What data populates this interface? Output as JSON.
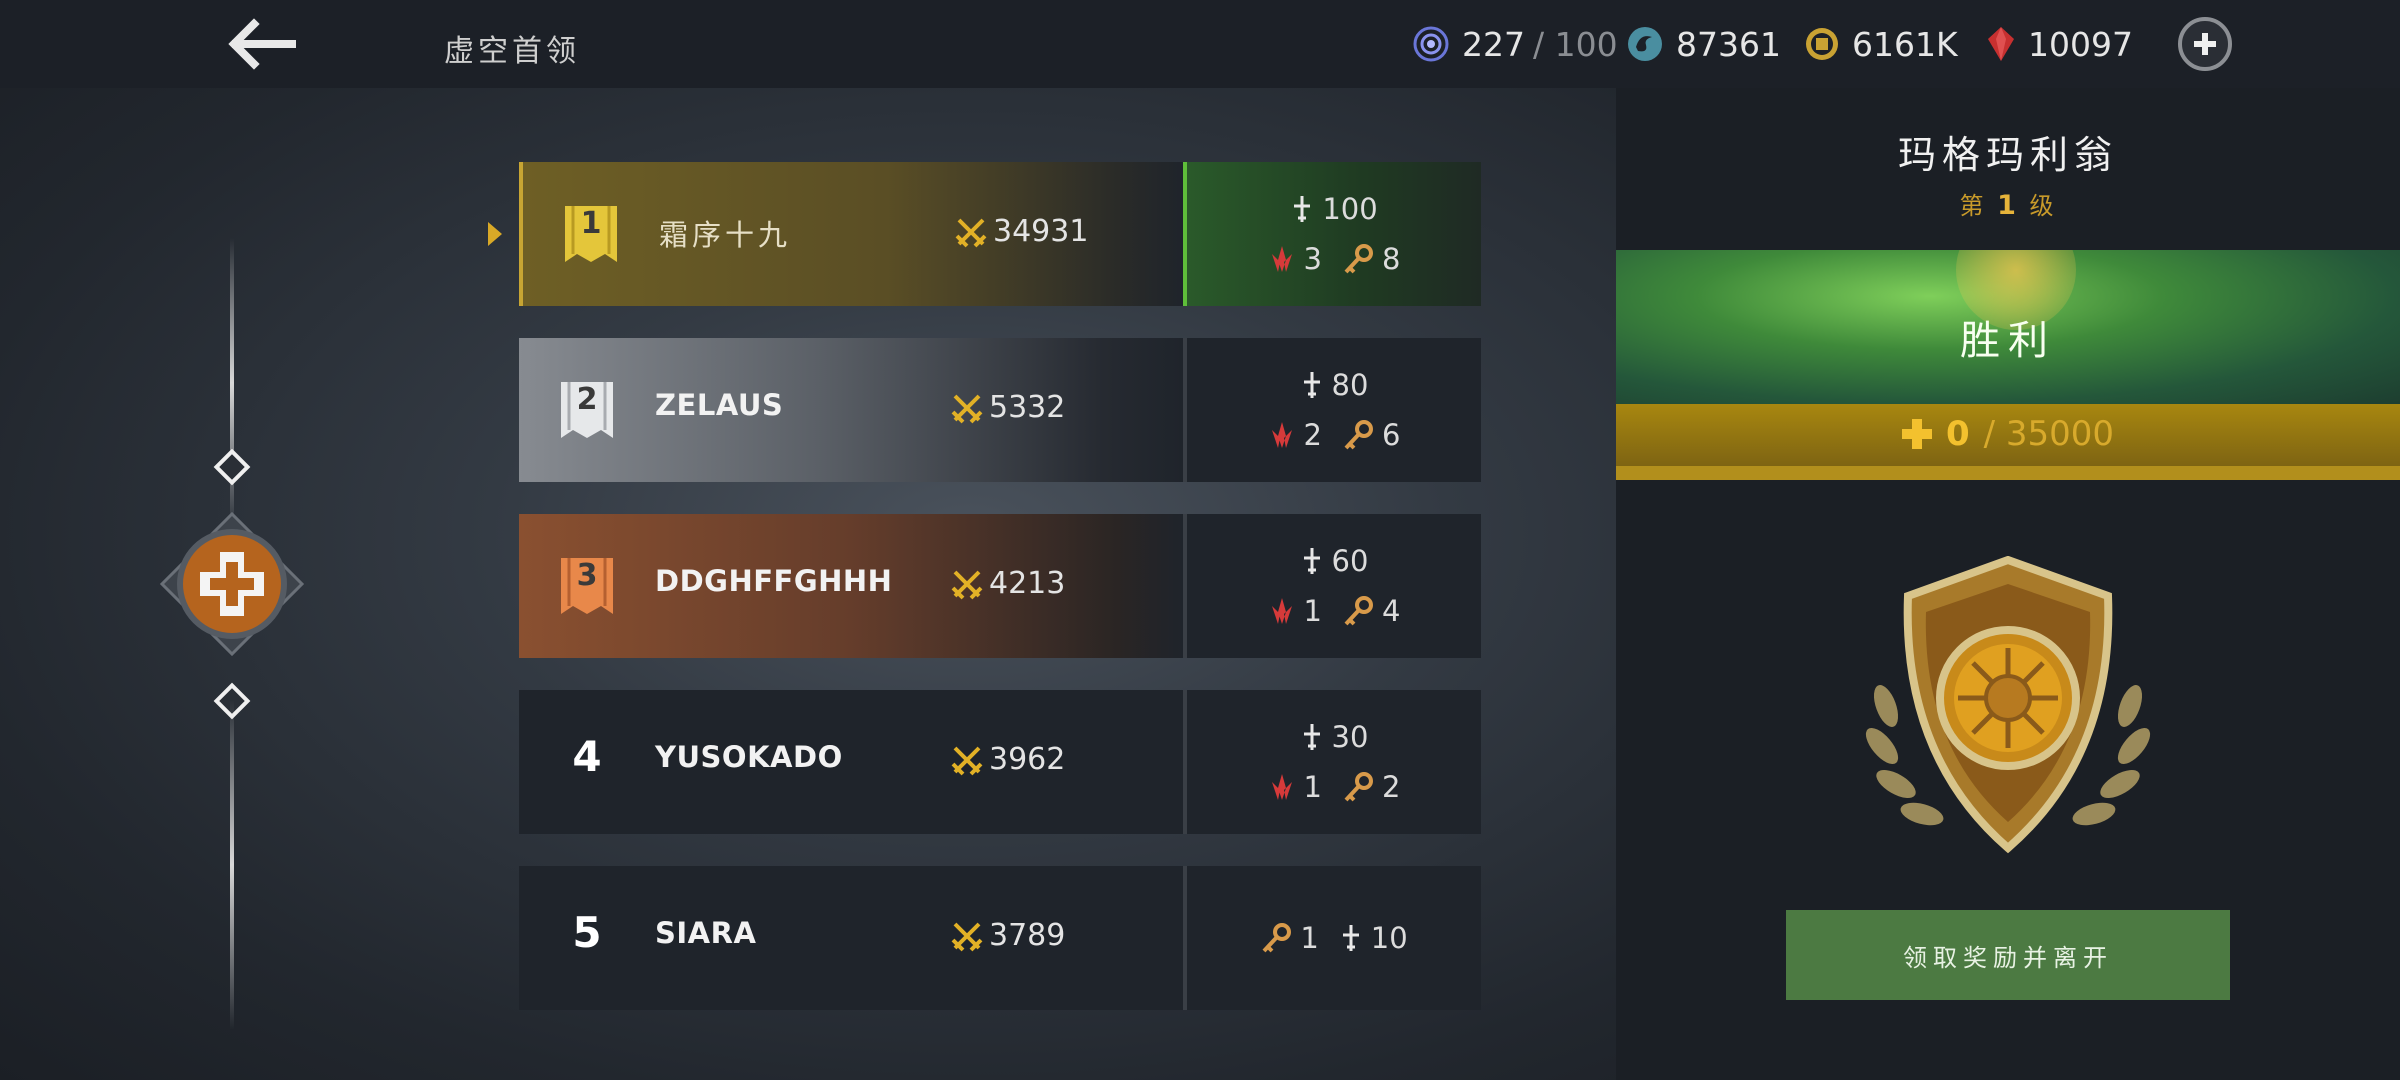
{
  "header": {
    "page_title": "虚空首领",
    "resources": [
      {
        "name": "energy",
        "icon": "energy-orb-icon",
        "value": "227",
        "max": "/ 100"
      },
      {
        "name": "silver",
        "icon": "swirl-coin-icon",
        "value": "87361"
      },
      {
        "name": "gold",
        "icon": "gold-coin-icon",
        "value": "6161K"
      },
      {
        "name": "gems",
        "icon": "red-gem-icon",
        "value": "10097"
      }
    ]
  },
  "leaderboard": [
    {
      "rank": "1",
      "name": "霜序十九",
      "power": "34931",
      "reward_a": "100",
      "reward_b": "3",
      "reward_c": "8"
    },
    {
      "rank": "2",
      "name": "ZELAUS",
      "power": "5332",
      "reward_a": "80",
      "reward_b": "2",
      "reward_c": "6"
    },
    {
      "rank": "3",
      "name": "DDGHFFGHHH",
      "power": "4213",
      "reward_a": "60",
      "reward_b": "1",
      "reward_c": "4"
    },
    {
      "rank": "4",
      "name": "YUSOKADO",
      "power": "3962",
      "reward_a": "30",
      "reward_b": "1",
      "reward_c": "2"
    },
    {
      "rank": "5",
      "name": "SIARA",
      "power": "3789",
      "reward_key": "1",
      "reward_sword": "10"
    }
  ],
  "boss": {
    "name": "玛格玛利翁",
    "level_prefix": "第",
    "level": "1",
    "level_suffix": "级",
    "result": "胜利",
    "progress_value": "0",
    "progress_max": "/ 35000"
  },
  "claim_button": "领取奖励并离开",
  "colors": {
    "gold_accent": "#d9a927",
    "victory_green": "#3f8a3a",
    "claim_green": "#4c7a42",
    "progress_gold": "#a88710"
  }
}
